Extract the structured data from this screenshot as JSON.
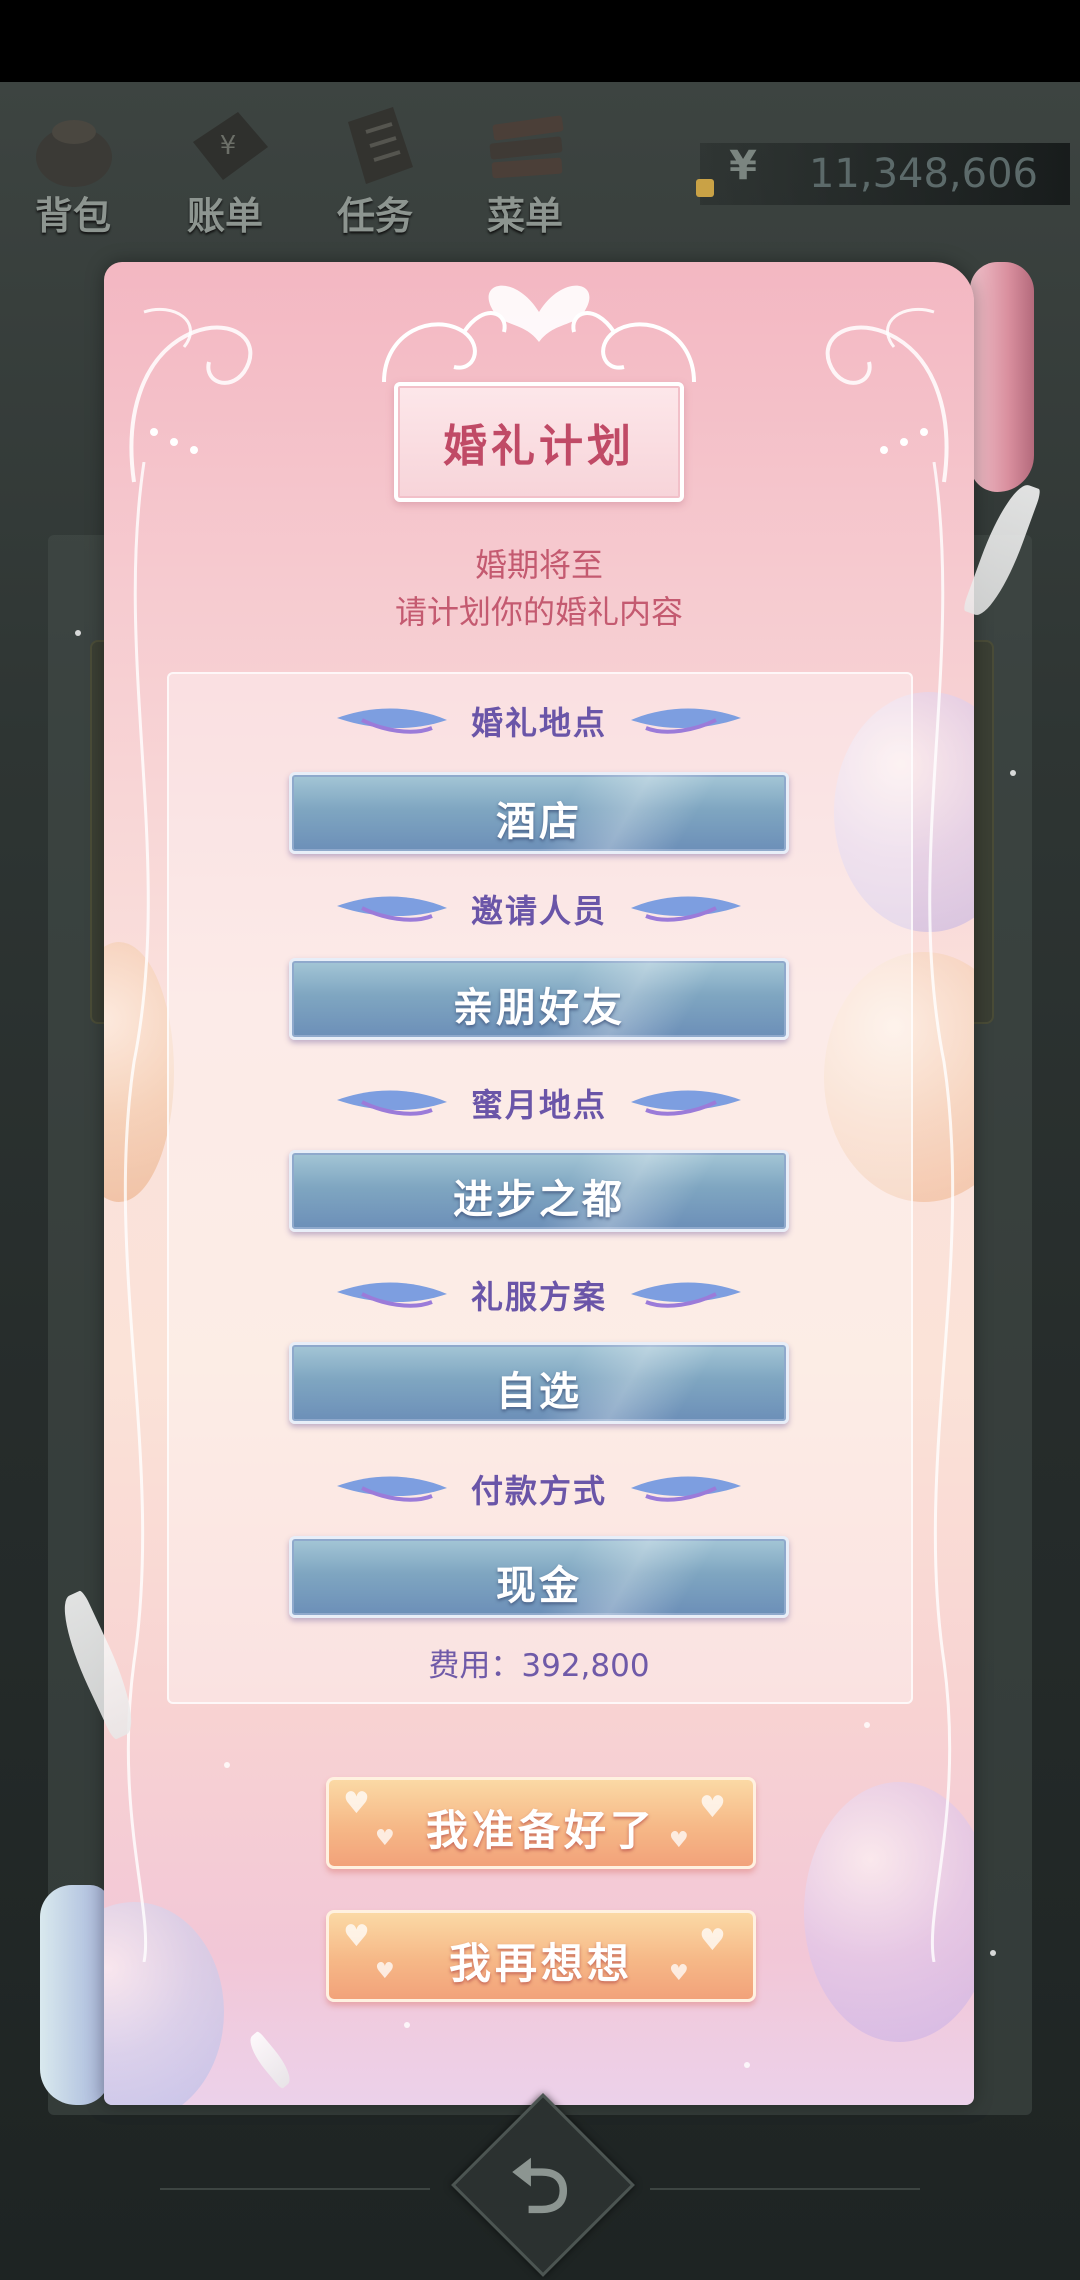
{
  "top_nav": {
    "items": [
      {
        "label": "背包",
        "icon": "bag-icon"
      },
      {
        "label": "账单",
        "icon": "bill-icon"
      },
      {
        "label": "任务",
        "icon": "task-icon"
      },
      {
        "label": "菜单",
        "icon": "menu-icon"
      }
    ]
  },
  "money": {
    "currency_symbol": "¥",
    "value": "11,348,606"
  },
  "dialog": {
    "title": "婚礼计划",
    "subtitle_line1": "婚期将至",
    "subtitle_line2": "请计划你的婚礼内容",
    "sections": [
      {
        "label": "婚礼地点",
        "value": "酒店"
      },
      {
        "label": "邀请人员",
        "value": "亲朋好友"
      },
      {
        "label": "蜜月地点",
        "value": "进步之都"
      },
      {
        "label": "礼服方案",
        "value": "自选"
      },
      {
        "label": "付款方式",
        "value": "现金"
      }
    ],
    "fee": "费用：392,800",
    "confirm_label": "我准备好了",
    "reconsider_label": "我再想想"
  },
  "back_button": {
    "icon": "back-arrow-icon",
    "glyph": "⮌"
  },
  "colors": {
    "title": "#c04a66",
    "section_label": "#6a55a8",
    "option_button": "#7fa6c1",
    "action_button": "#f6b887"
  }
}
